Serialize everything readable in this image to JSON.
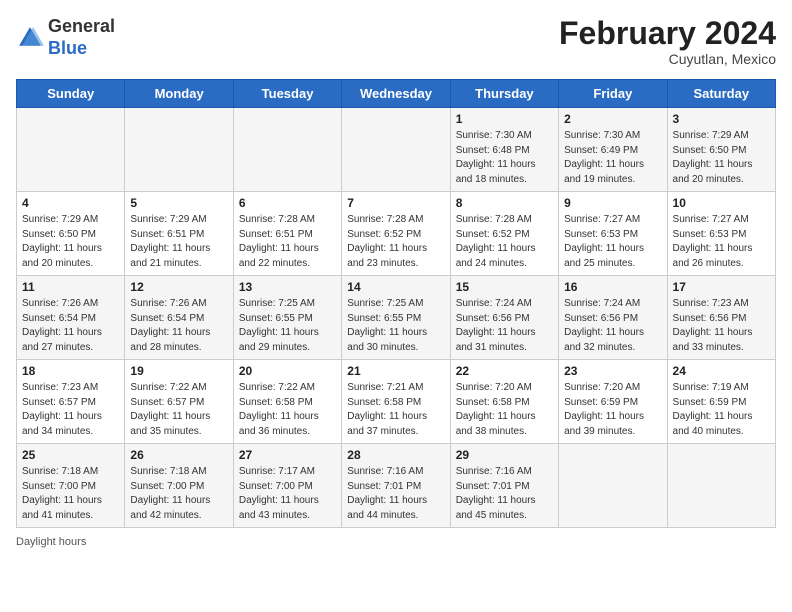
{
  "header": {
    "logo_line1": "General",
    "logo_line2": "Blue",
    "month_year": "February 2024",
    "location": "Cuyutlan, Mexico"
  },
  "days_of_week": [
    "Sunday",
    "Monday",
    "Tuesday",
    "Wednesday",
    "Thursday",
    "Friday",
    "Saturday"
  ],
  "weeks": [
    [
      {
        "day": "",
        "info": ""
      },
      {
        "day": "",
        "info": ""
      },
      {
        "day": "",
        "info": ""
      },
      {
        "day": "",
        "info": ""
      },
      {
        "day": "1",
        "info": "Sunrise: 7:30 AM\nSunset: 6:48 PM\nDaylight: 11 hours\nand 18 minutes."
      },
      {
        "day": "2",
        "info": "Sunrise: 7:30 AM\nSunset: 6:49 PM\nDaylight: 11 hours\nand 19 minutes."
      },
      {
        "day": "3",
        "info": "Sunrise: 7:29 AM\nSunset: 6:50 PM\nDaylight: 11 hours\nand 20 minutes."
      }
    ],
    [
      {
        "day": "4",
        "info": "Sunrise: 7:29 AM\nSunset: 6:50 PM\nDaylight: 11 hours\nand 20 minutes."
      },
      {
        "day": "5",
        "info": "Sunrise: 7:29 AM\nSunset: 6:51 PM\nDaylight: 11 hours\nand 21 minutes."
      },
      {
        "day": "6",
        "info": "Sunrise: 7:28 AM\nSunset: 6:51 PM\nDaylight: 11 hours\nand 22 minutes."
      },
      {
        "day": "7",
        "info": "Sunrise: 7:28 AM\nSunset: 6:52 PM\nDaylight: 11 hours\nand 23 minutes."
      },
      {
        "day": "8",
        "info": "Sunrise: 7:28 AM\nSunset: 6:52 PM\nDaylight: 11 hours\nand 24 minutes."
      },
      {
        "day": "9",
        "info": "Sunrise: 7:27 AM\nSunset: 6:53 PM\nDaylight: 11 hours\nand 25 minutes."
      },
      {
        "day": "10",
        "info": "Sunrise: 7:27 AM\nSunset: 6:53 PM\nDaylight: 11 hours\nand 26 minutes."
      }
    ],
    [
      {
        "day": "11",
        "info": "Sunrise: 7:26 AM\nSunset: 6:54 PM\nDaylight: 11 hours\nand 27 minutes."
      },
      {
        "day": "12",
        "info": "Sunrise: 7:26 AM\nSunset: 6:54 PM\nDaylight: 11 hours\nand 28 minutes."
      },
      {
        "day": "13",
        "info": "Sunrise: 7:25 AM\nSunset: 6:55 PM\nDaylight: 11 hours\nand 29 minutes."
      },
      {
        "day": "14",
        "info": "Sunrise: 7:25 AM\nSunset: 6:55 PM\nDaylight: 11 hours\nand 30 minutes."
      },
      {
        "day": "15",
        "info": "Sunrise: 7:24 AM\nSunset: 6:56 PM\nDaylight: 11 hours\nand 31 minutes."
      },
      {
        "day": "16",
        "info": "Sunrise: 7:24 AM\nSunset: 6:56 PM\nDaylight: 11 hours\nand 32 minutes."
      },
      {
        "day": "17",
        "info": "Sunrise: 7:23 AM\nSunset: 6:56 PM\nDaylight: 11 hours\nand 33 minutes."
      }
    ],
    [
      {
        "day": "18",
        "info": "Sunrise: 7:23 AM\nSunset: 6:57 PM\nDaylight: 11 hours\nand 34 minutes."
      },
      {
        "day": "19",
        "info": "Sunrise: 7:22 AM\nSunset: 6:57 PM\nDaylight: 11 hours\nand 35 minutes."
      },
      {
        "day": "20",
        "info": "Sunrise: 7:22 AM\nSunset: 6:58 PM\nDaylight: 11 hours\nand 36 minutes."
      },
      {
        "day": "21",
        "info": "Sunrise: 7:21 AM\nSunset: 6:58 PM\nDaylight: 11 hours\nand 37 minutes."
      },
      {
        "day": "22",
        "info": "Sunrise: 7:20 AM\nSunset: 6:58 PM\nDaylight: 11 hours\nand 38 minutes."
      },
      {
        "day": "23",
        "info": "Sunrise: 7:20 AM\nSunset: 6:59 PM\nDaylight: 11 hours\nand 39 minutes."
      },
      {
        "day": "24",
        "info": "Sunrise: 7:19 AM\nSunset: 6:59 PM\nDaylight: 11 hours\nand 40 minutes."
      }
    ],
    [
      {
        "day": "25",
        "info": "Sunrise: 7:18 AM\nSunset: 7:00 PM\nDaylight: 11 hours\nand 41 minutes."
      },
      {
        "day": "26",
        "info": "Sunrise: 7:18 AM\nSunset: 7:00 PM\nDaylight: 11 hours\nand 42 minutes."
      },
      {
        "day": "27",
        "info": "Sunrise: 7:17 AM\nSunset: 7:00 PM\nDaylight: 11 hours\nand 43 minutes."
      },
      {
        "day": "28",
        "info": "Sunrise: 7:16 AM\nSunset: 7:01 PM\nDaylight: 11 hours\nand 44 minutes."
      },
      {
        "day": "29",
        "info": "Sunrise: 7:16 AM\nSunset: 7:01 PM\nDaylight: 11 hours\nand 45 minutes."
      },
      {
        "day": "",
        "info": ""
      },
      {
        "day": "",
        "info": ""
      }
    ]
  ],
  "footer": {
    "daylight_label": "Daylight hours"
  }
}
